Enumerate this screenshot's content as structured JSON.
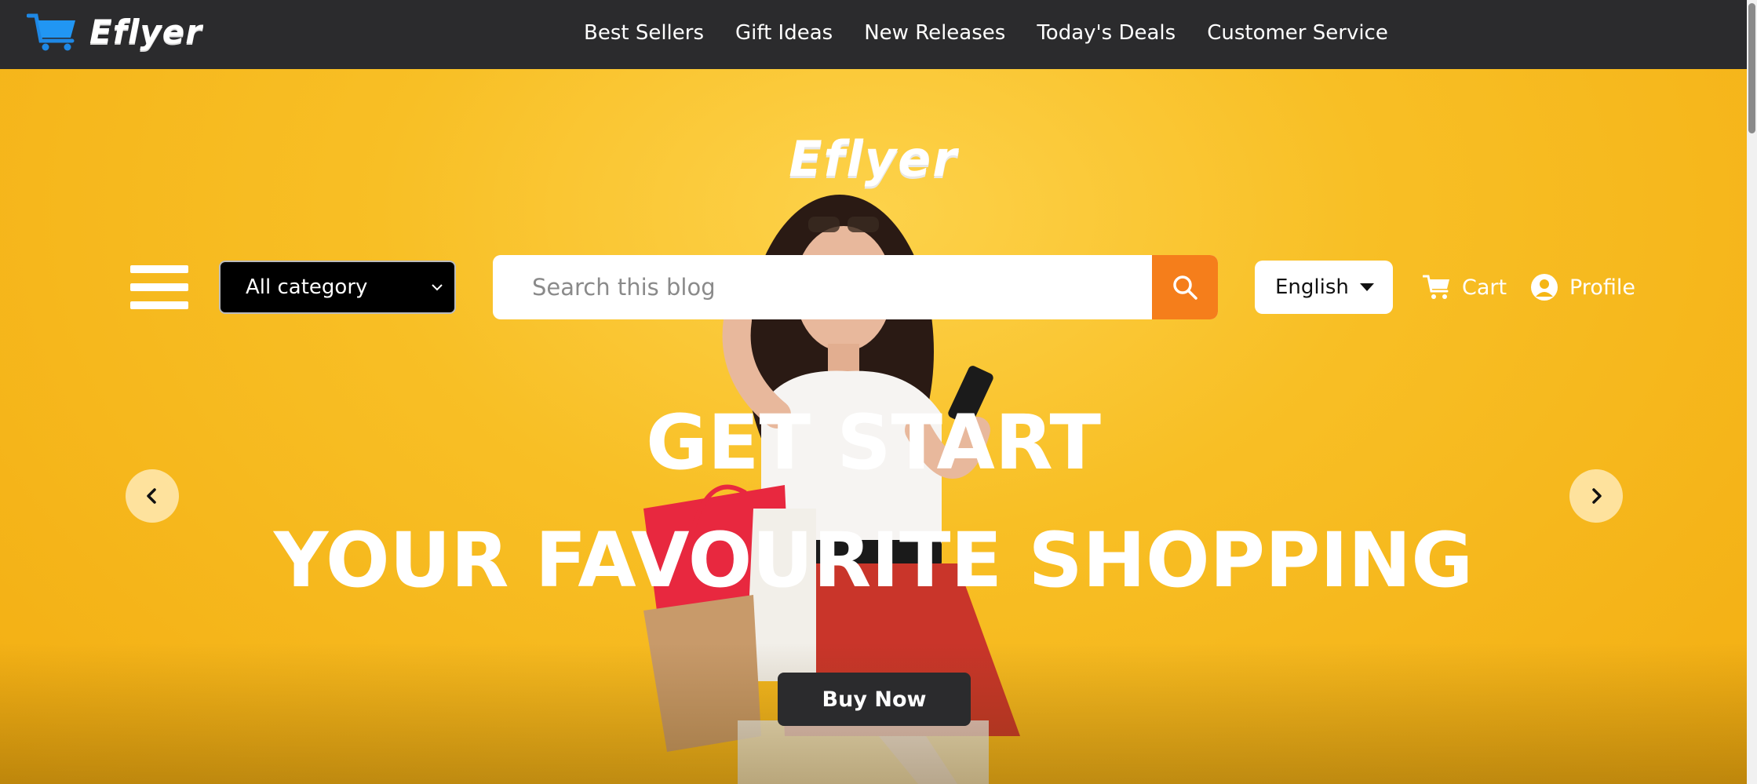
{
  "brand": {
    "name": "Eflyer",
    "cart_icon": "shopping-cart-icon"
  },
  "nav": {
    "items": [
      {
        "label": "Best Sellers"
      },
      {
        "label": "Gift Ideas"
      },
      {
        "label": "New Releases"
      },
      {
        "label": "Today's Deals"
      },
      {
        "label": "Customer Service"
      }
    ]
  },
  "hero": {
    "logo_text": "Eflyer",
    "headline_line1": "GET START",
    "headline_line2": "YOUR FAVOURITE SHOPPING",
    "buy_button": "Buy Now"
  },
  "toolbar": {
    "menu_icon": "hamburger-menu-icon",
    "category_select": {
      "value": "All category"
    },
    "search": {
      "placeholder": "Search this blog",
      "icon": "search-icon"
    },
    "language": {
      "value": "English"
    },
    "cart_label": "Cart",
    "profile_label": "Profile"
  },
  "colors": {
    "navbar": "#2b2b2d",
    "hero_bg": "#f8bf25",
    "search_button": "#f57e1b",
    "brand_cart": "#1e88e5"
  }
}
